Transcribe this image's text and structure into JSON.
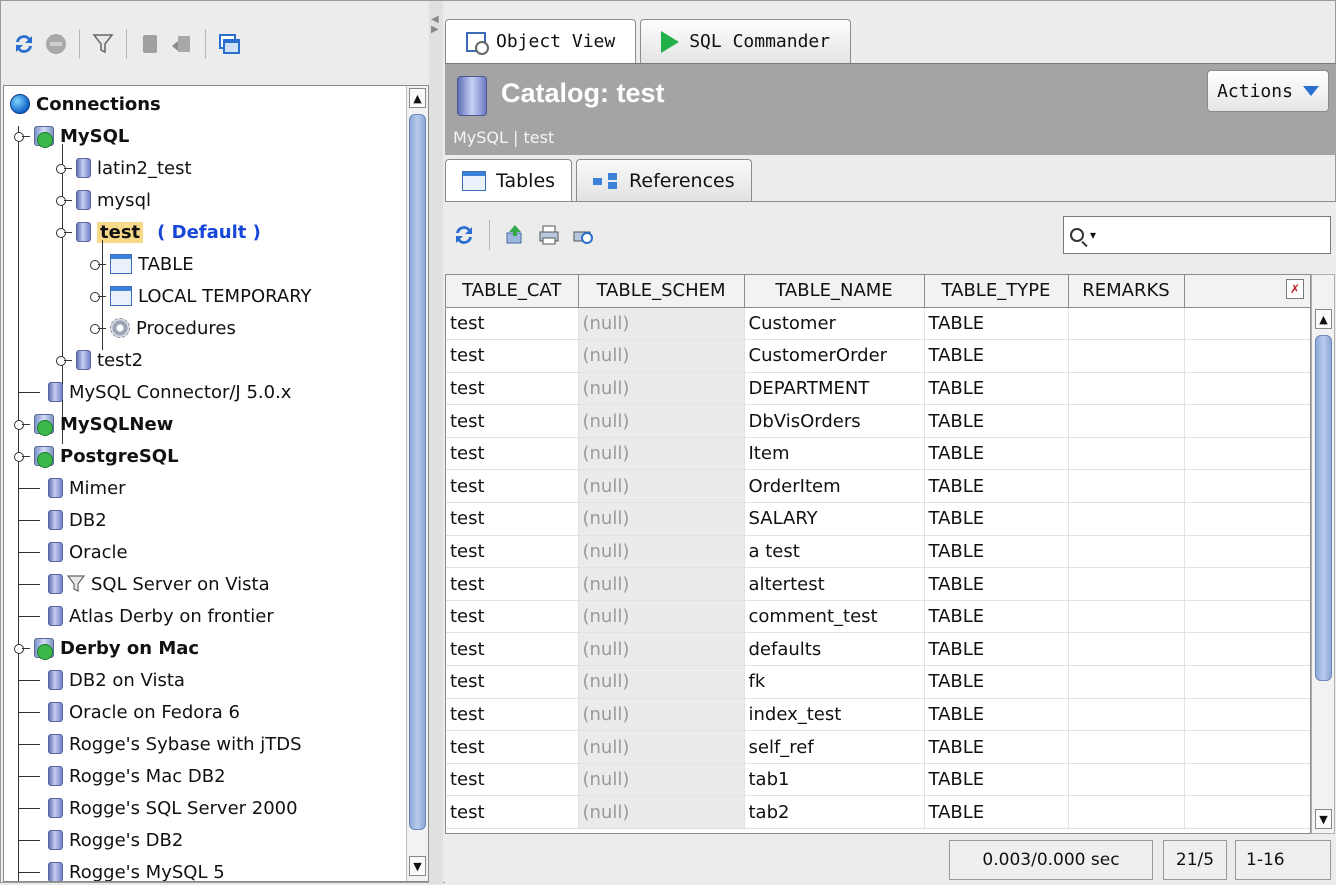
{
  "left_toolbar": {
    "icons": [
      "refresh-icon",
      "stop-icon",
      "filter-icon",
      "database-icon",
      "export-icon",
      "windows-icon"
    ]
  },
  "tree": {
    "root_label": "Connections",
    "items": [
      {
        "label": "MySQL",
        "bold": true
      },
      {
        "label": "latin2_test"
      },
      {
        "label": "mysql"
      },
      {
        "label": "test",
        "default_tag": "( Default )"
      },
      {
        "label": "TABLE"
      },
      {
        "label": "LOCAL TEMPORARY"
      },
      {
        "label": "Procedures"
      },
      {
        "label": "test2"
      },
      {
        "label": "MySQL Connector/J 5.0.x"
      },
      {
        "label": "MySQLNew",
        "bold": true
      },
      {
        "label": "PostgreSQL",
        "bold": true
      },
      {
        "label": "Mimer"
      },
      {
        "label": "DB2"
      },
      {
        "label": "Oracle"
      },
      {
        "label": "SQL Server on Vista"
      },
      {
        "label": "Atlas Derby on frontier"
      },
      {
        "label": "Derby on Mac",
        "bold": true
      },
      {
        "label": "DB2 on Vista"
      },
      {
        "label": "Oracle on Fedora 6"
      },
      {
        "label": "Rogge's Sybase with jTDS"
      },
      {
        "label": "Rogge's Mac DB2"
      },
      {
        "label": "Rogge's SQL Server 2000"
      },
      {
        "label": "Rogge's DB2"
      },
      {
        "label": "Rogge's MySQL 5"
      }
    ]
  },
  "main_tabs": [
    {
      "label": "Object View",
      "active": true
    },
    {
      "label": "SQL Commander",
      "active": false
    }
  ],
  "catalog": {
    "title": "Catalog: test",
    "subtitle": "MySQL | test",
    "actions_label": "Actions"
  },
  "sub_tabs": [
    {
      "label": "Tables",
      "active": true
    },
    {
      "label": "References",
      "active": false
    }
  ],
  "search": {
    "value": ""
  },
  "grid": {
    "columns": [
      "TABLE_CAT",
      "TABLE_SCHEM",
      "TABLE_NAME",
      "TABLE_TYPE",
      "REMARKS"
    ],
    "rows": [
      [
        "test",
        "(null)",
        "Customer",
        "TABLE",
        ""
      ],
      [
        "test",
        "(null)",
        "CustomerOrder",
        "TABLE",
        ""
      ],
      [
        "test",
        "(null)",
        "DEPARTMENT",
        "TABLE",
        ""
      ],
      [
        "test",
        "(null)",
        "DbVisOrders",
        "TABLE",
        ""
      ],
      [
        "test",
        "(null)",
        "Item",
        "TABLE",
        ""
      ],
      [
        "test",
        "(null)",
        "OrderItem",
        "TABLE",
        ""
      ],
      [
        "test",
        "(null)",
        "SALARY",
        "TABLE",
        ""
      ],
      [
        "test",
        "(null)",
        "a test",
        "TABLE",
        ""
      ],
      [
        "test",
        "(null)",
        "altertest",
        "TABLE",
        ""
      ],
      [
        "test",
        "(null)",
        "comment_test",
        "TABLE",
        ""
      ],
      [
        "test",
        "(null)",
        "defaults",
        "TABLE",
        ""
      ],
      [
        "test",
        "(null)",
        "fk",
        "TABLE",
        ""
      ],
      [
        "test",
        "(null)",
        "index_test",
        "TABLE",
        ""
      ],
      [
        "test",
        "(null)",
        "self_ref",
        "TABLE",
        ""
      ],
      [
        "test",
        "(null)",
        "tab1",
        "TABLE",
        ""
      ],
      [
        "test",
        "(null)",
        "tab2",
        "TABLE",
        ""
      ]
    ]
  },
  "status": {
    "timing": "0.003/0.000 sec",
    "counts": "21/5",
    "range": "1-16"
  },
  "colors": {
    "header_bg": "#a4a4a4",
    "accent_blue": "#1747d9",
    "selection": "#f7d98a",
    "null_text": "#9a9a9a"
  }
}
